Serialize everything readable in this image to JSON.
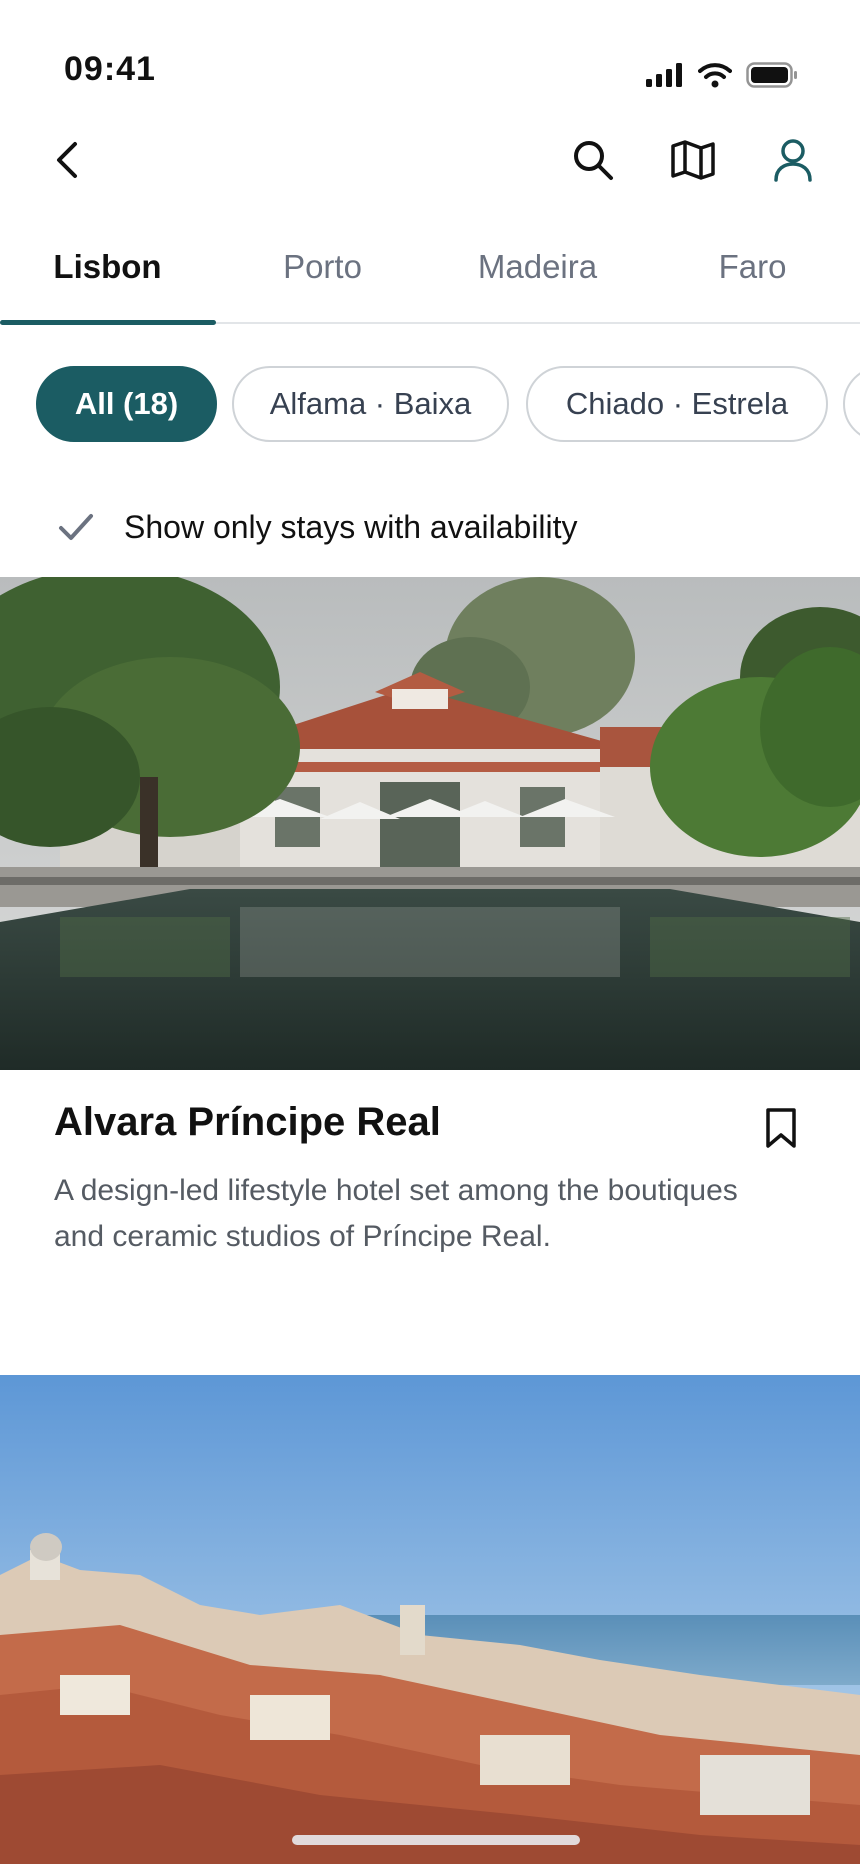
{
  "status_bar": {
    "time": "09:41"
  },
  "header": {
    "back_icon": "chevron-left-icon",
    "search_icon": "search-icon",
    "map_icon": "map-icon",
    "profile_icon": "user-icon"
  },
  "city_tabs": [
    {
      "label": "Lisbon",
      "active": true
    },
    {
      "label": "Porto",
      "active": false
    },
    {
      "label": "Madeira",
      "active": false
    },
    {
      "label": "Faro",
      "active": false
    }
  ],
  "filter_chips": [
    {
      "label": "All (18)",
      "active": true
    },
    {
      "label": "Alfama · Baixa",
      "active": false
    },
    {
      "label": "Chiado · Estrela",
      "active": false
    }
  ],
  "availability": {
    "label": "Show only stays with availability",
    "checked": true
  },
  "cards": [
    {
      "title": "Alvara Príncipe Real",
      "description": "A design-led lifestyle hotel set among the boutiques and ceramic studios of Príncipe Real."
    }
  ],
  "colors": {
    "accent": "#1b5c63",
    "muted_text": "#6b7280",
    "border": "#cfd3d7"
  }
}
